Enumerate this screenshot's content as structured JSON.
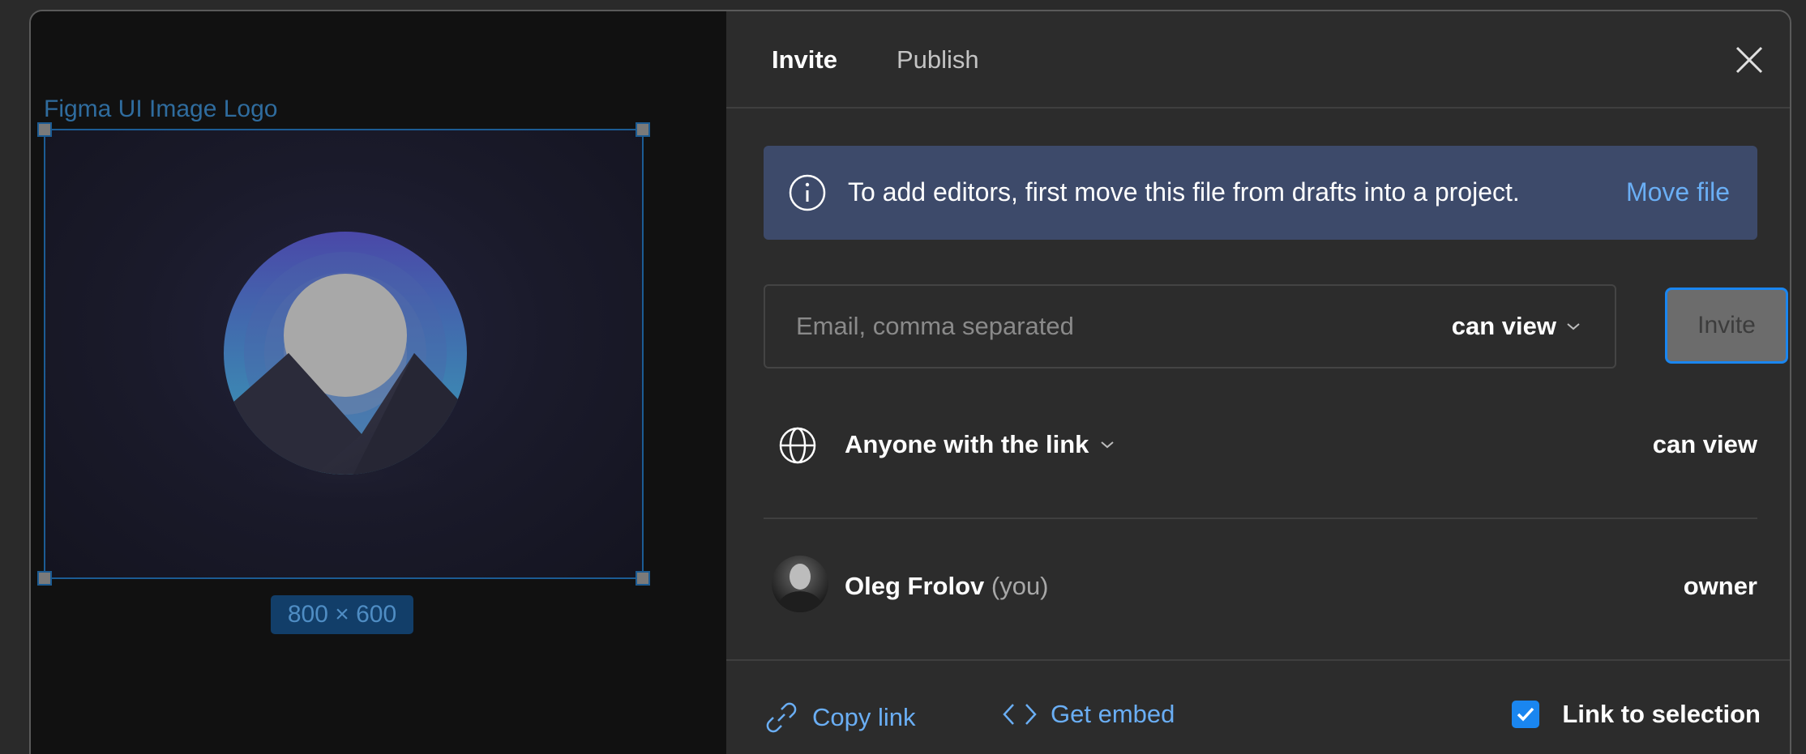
{
  "canvas": {
    "frame_label": "Figma UI Image Logo",
    "size_badge": "800 × 600",
    "logo_icon": "mountain-sun-logo"
  },
  "tabs": [
    {
      "label": "Invite",
      "active": true
    },
    {
      "label": "Publish",
      "active": false
    }
  ],
  "close_icon": "close-icon",
  "banner": {
    "icon": "info-icon",
    "text": "To add editors, first move this file from drafts into a project.",
    "link": "Move file"
  },
  "invite_form": {
    "email_placeholder": "Email, comma separated",
    "email_value": "",
    "permission": "can view",
    "invite_label": "Invite"
  },
  "link_access": {
    "icon": "globe-icon",
    "label": "Anyone with the link",
    "permission": "can view"
  },
  "members": [
    {
      "name": "Oleg Frolov",
      "suffix": "(you)",
      "role": "owner"
    }
  ],
  "footer": {
    "copy_link": "Copy link",
    "get_embed": "Get embed",
    "link_to_selection": "Link to selection",
    "link_to_selection_checked": true
  },
  "colors": {
    "accent": "#1a86f0",
    "link": "#6aaef4",
    "banner_bg": "#3d4a6a",
    "panel_bg": "#2c2c2c",
    "canvas_bg": "#111111"
  }
}
